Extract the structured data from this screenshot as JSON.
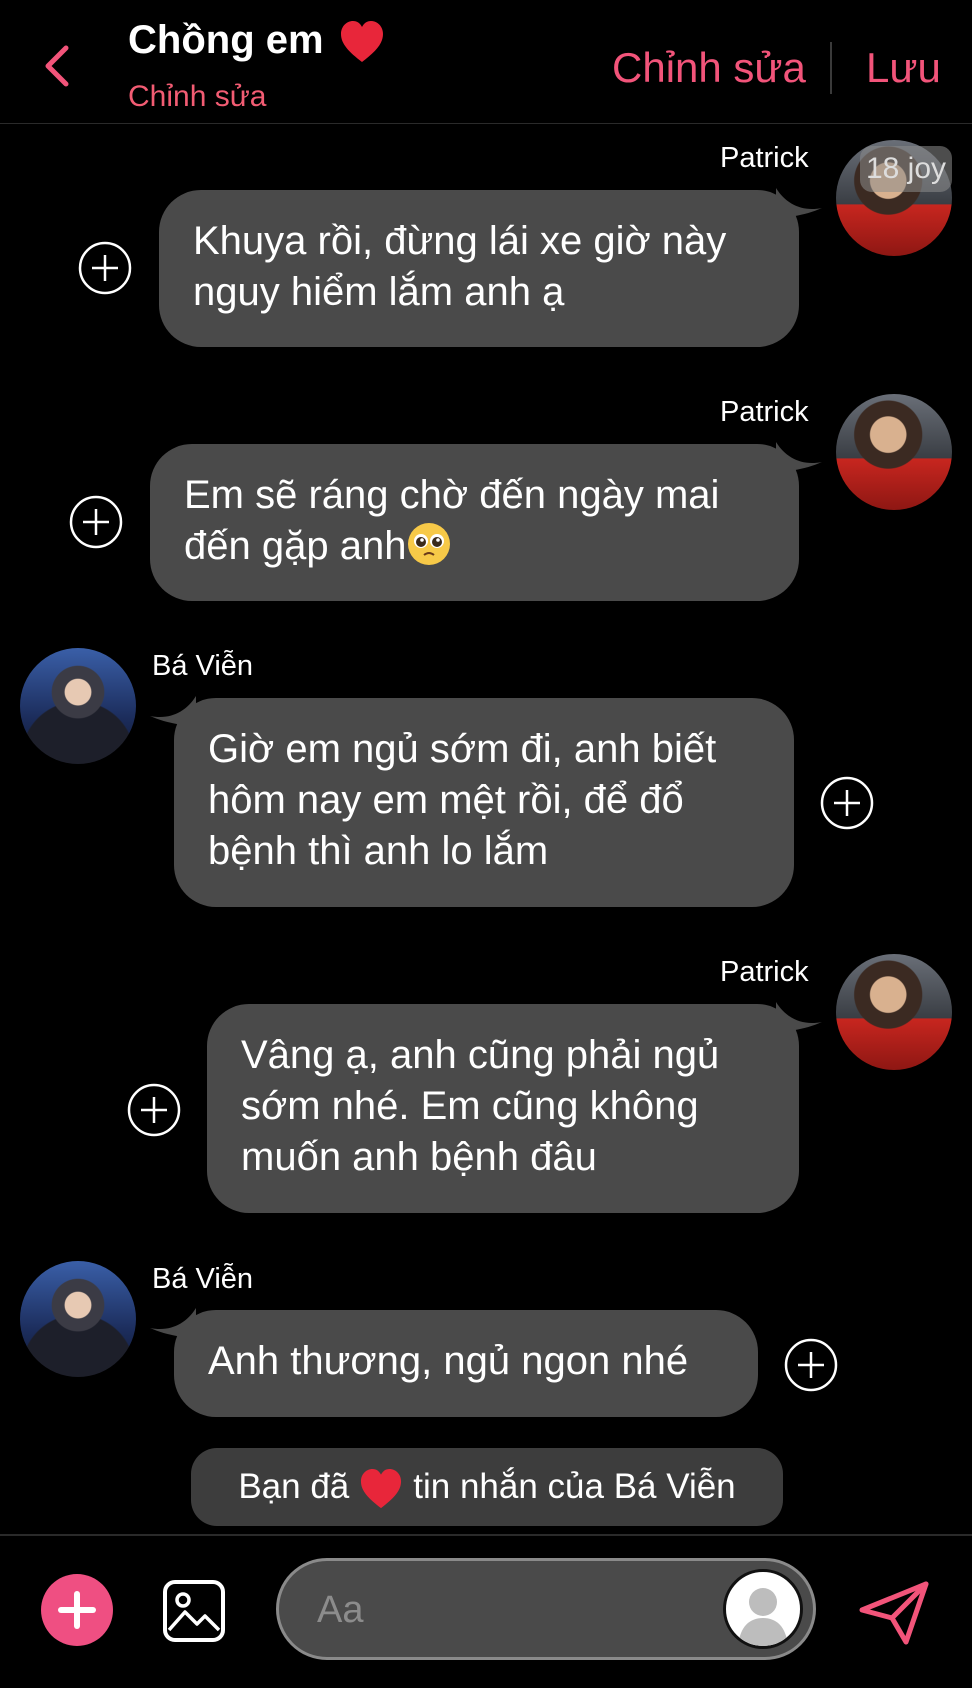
{
  "header": {
    "title": "Chồng em",
    "subtitle": "Chỉnh sửa",
    "edit_label": "Chỉnh sửa",
    "save_label": "Lưu"
  },
  "watermark": "18 joy",
  "messages": [
    {
      "sender": "Patrick",
      "text": "Khuya rồi, đừng lái xe giờ này nguy hiểm lắm anh ạ"
    },
    {
      "sender": "Patrick",
      "text": "Em sẽ ráng chờ đến ngày mai đến gặp anh"
    },
    {
      "sender": "Bá Viễn",
      "text": "Giờ em ngủ sớm đi, anh biết hôm nay em mệt rồi, để đổ bệnh thì anh lo lắm"
    },
    {
      "sender": "Patrick",
      "text": "Vâng ạ, anh cũng phải ngủ sớm nhé. Em cũng không muốn anh bệnh đâu"
    },
    {
      "sender": "Bá Viễn",
      "text": "Anh thương, ngủ ngon nhé"
    }
  ],
  "reaction_notice": {
    "prefix": "Bạn đã",
    "suffix": "tin nhắn của Bá Viễn"
  },
  "composer": {
    "placeholder": "Aa"
  },
  "colors": {
    "accent": "#f2547a",
    "bubble": "#4a4a4a",
    "background": "#000000"
  }
}
